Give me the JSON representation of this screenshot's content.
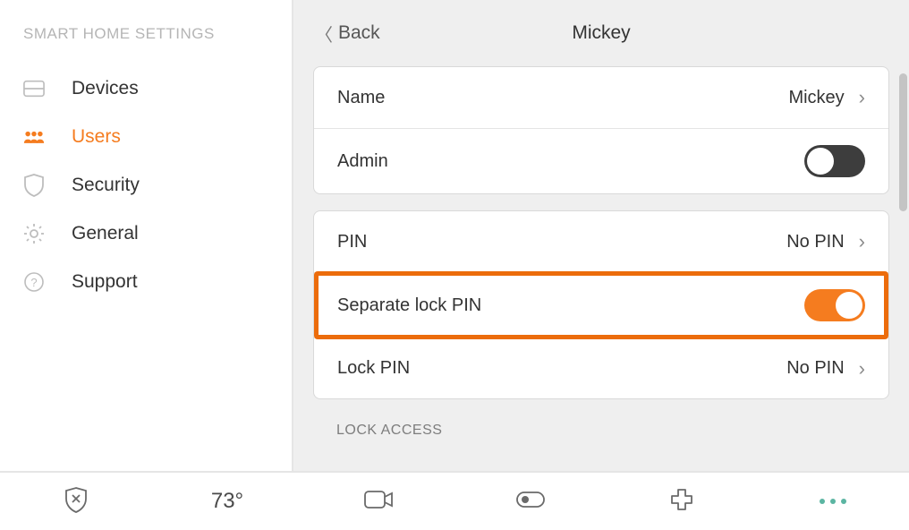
{
  "sidebar": {
    "title": "SMART HOME SETTINGS",
    "items": [
      {
        "label": "Devices"
      },
      {
        "label": "Users"
      },
      {
        "label": "Security"
      },
      {
        "label": "General"
      },
      {
        "label": "Support"
      }
    ]
  },
  "header": {
    "back_label": "Back",
    "title": "Mickey"
  },
  "user_section": {
    "name_label": "Name",
    "name_value": "Mickey",
    "admin_label": "Admin",
    "admin_on": false
  },
  "pin_section": {
    "pin_label": "PIN",
    "pin_value": "No PIN",
    "separate_label": "Separate lock PIN",
    "separate_on": true,
    "lockpin_label": "Lock PIN",
    "lockpin_value": "No PIN"
  },
  "lock_access_header": "LOCK ACCESS",
  "bottom": {
    "temp": "73°"
  }
}
